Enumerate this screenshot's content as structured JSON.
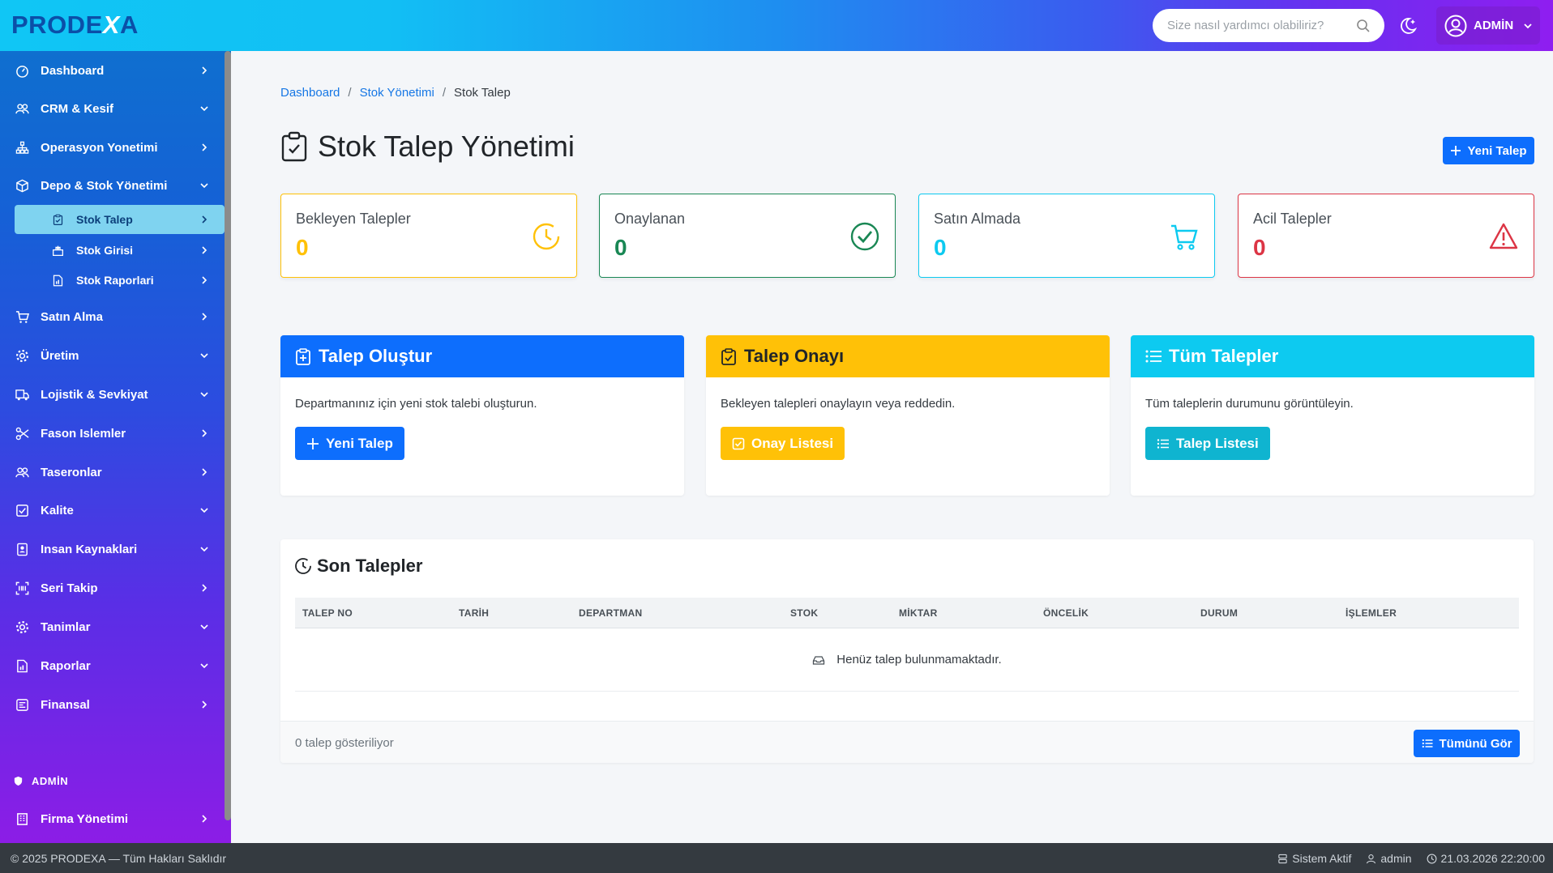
{
  "brand": {
    "prefix": "PRODE",
    "x": "X",
    "suffix": "A"
  },
  "search": {
    "placeholder": "Size nasıl yardımcı olabiliriz?"
  },
  "user": {
    "name": "ADMİN"
  },
  "sidebar": {
    "items": [
      {
        "label": "Dashboard",
        "icon": "gauge-icon",
        "arrow": "right"
      },
      {
        "label": "CRM & Kesif",
        "icon": "users-icon",
        "arrow": "down"
      },
      {
        "label": "Operasyon Yonetimi",
        "icon": "sitemap-icon",
        "arrow": "right"
      },
      {
        "label": "Depo & Stok Yönetimi",
        "icon": "box-icon",
        "arrow": "down"
      },
      {
        "label": "Satın Alma",
        "icon": "cart-icon",
        "arrow": "right"
      },
      {
        "label": "Üretim",
        "icon": "gear-icon",
        "arrow": "down"
      },
      {
        "label": "Lojistik & Sevkiyat",
        "icon": "truck-icon",
        "arrow": "down"
      },
      {
        "label": "Fason Islemler",
        "icon": "scissors-icon",
        "arrow": "right"
      },
      {
        "label": "Taseronlar",
        "icon": "users-icon",
        "arrow": "right"
      },
      {
        "label": "Kalite",
        "icon": "check-square-icon",
        "arrow": "down"
      },
      {
        "label": "Insan Kaynaklari",
        "icon": "id-card-icon",
        "arrow": "down"
      },
      {
        "label": "Seri Takip",
        "icon": "scan-icon",
        "arrow": "right"
      },
      {
        "label": "Tanimlar",
        "icon": "gear-icon",
        "arrow": "down"
      },
      {
        "label": "Raporlar",
        "icon": "report-icon",
        "arrow": "down"
      },
      {
        "label": "Finansal",
        "icon": "finance-icon",
        "arrow": "right"
      }
    ],
    "subitems": [
      {
        "label": "Stok Talep",
        "icon": "clipboard-icon"
      },
      {
        "label": "Stok Girisi",
        "icon": "box-in-icon"
      },
      {
        "label": "Stok Raporlari",
        "icon": "report-icon"
      }
    ],
    "section": "ADMİN",
    "admin_item": {
      "label": "Firma Yönetimi",
      "icon": "building-icon"
    }
  },
  "breadcrumb": {
    "home": "Dashboard",
    "parent": "Stok Yönetimi",
    "current": "Stok Talep",
    "sep": "/"
  },
  "page": {
    "title": "Stok Talep Yönetimi",
    "new_button": "Yeni Talep"
  },
  "stats": [
    {
      "label": "Bekleyen Talepler",
      "value": "0",
      "color": "#ffc107",
      "icon": "clock-icon"
    },
    {
      "label": "Onaylanan",
      "value": "0",
      "color": "#198754",
      "icon": "check-circle-icon"
    },
    {
      "label": "Satın Almada",
      "value": "0",
      "color": "#0dcaf0",
      "icon": "cart-icon"
    },
    {
      "label": "Acil Talepler",
      "value": "0",
      "color": "#dc3545",
      "icon": "warning-icon"
    }
  ],
  "cards": [
    {
      "title": "Talep Oluştur",
      "desc": "Departmanınız için yeni stok talebi oluşturun.",
      "button": "Yeni Talep",
      "color": "#0d6efd"
    },
    {
      "title": "Talep Onayı",
      "desc": "Bekleyen talepleri onaylayın veya reddedin.",
      "button": "Onay Listesi",
      "color": "#ffc107"
    },
    {
      "title": "Tüm Talepler",
      "desc": "Tüm taleplerin durumunu görüntüleyin.",
      "button": "Talep Listesi",
      "color": "#0dcaf0",
      "button_color": "#0fb4d0"
    }
  ],
  "table": {
    "title": "Son Talepler",
    "columns": [
      "TALEP NO",
      "TARİH",
      "DEPARTMAN",
      "STOK",
      "MİKTAR",
      "ÖNCELİK",
      "DURUM",
      "İŞLEMLER"
    ],
    "empty": "Henüz talep bulunmamaktadır.",
    "count_text": "0 talep gösteriliyor",
    "view_all": "Tümünü Gör"
  },
  "footer": {
    "copyright": "© 2025 PRODEXA — Tüm Hakları Saklıdır",
    "status": "Sistem Aktif",
    "user": "admin",
    "datetime": "21.03.2026 22:20:00"
  }
}
